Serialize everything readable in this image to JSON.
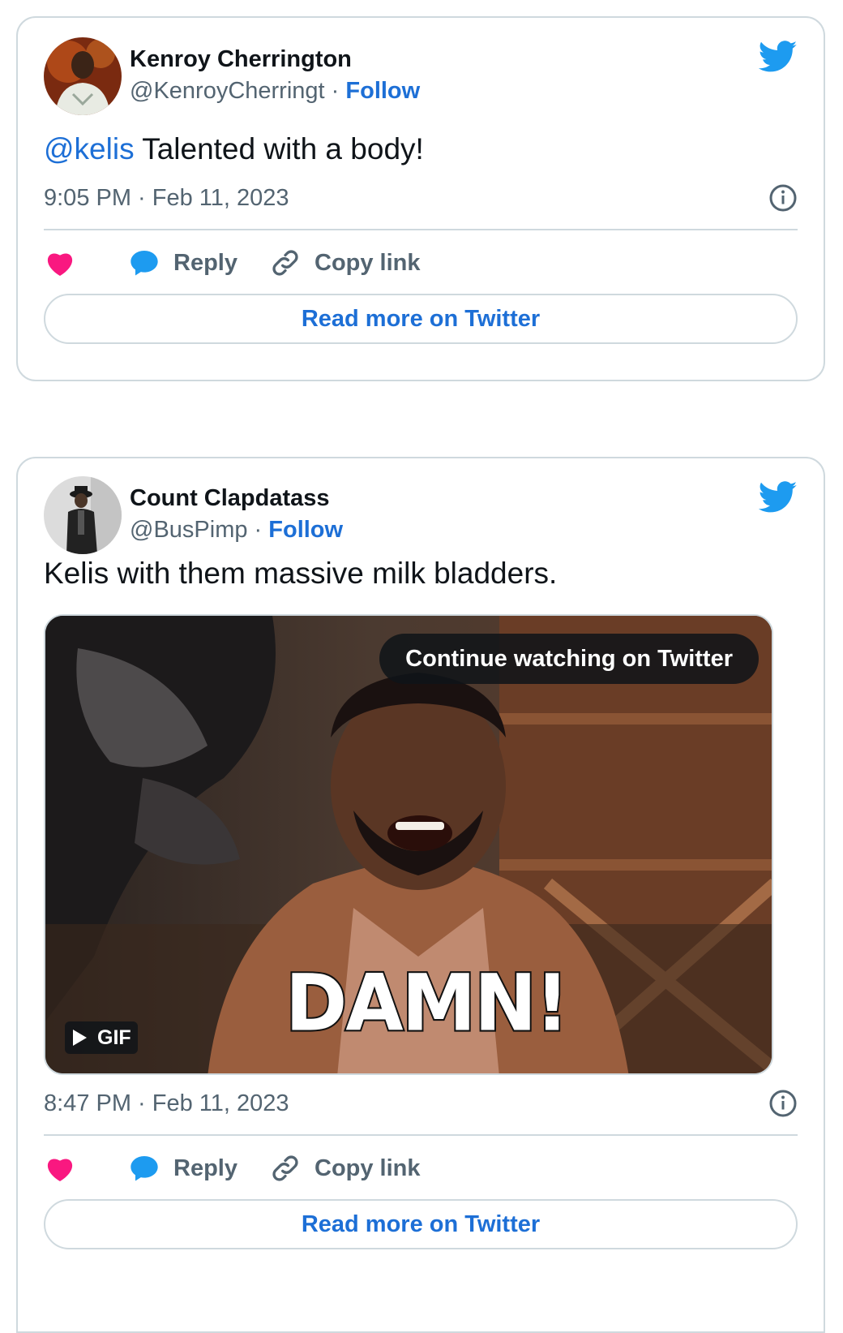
{
  "tweets": [
    {
      "author_name": "Kenroy Cherrington",
      "handle": "@KenroyCherringt",
      "separator": " · ",
      "follow_label": "Follow",
      "mention": "@kelis",
      "text": " Talented with a body!",
      "timestamp": "9:05 PM · Feb 11, 2023",
      "reply_label": "Reply",
      "copy_link_label": "Copy link",
      "read_more_label": "Read more on Twitter"
    },
    {
      "author_name": "Count Clapdatass",
      "handle": "@BusPimp",
      "separator": " · ",
      "follow_label": "Follow",
      "text": "Kelis with them massive milk bladders.",
      "media": {
        "continue_label": "Continue watching on Twitter",
        "gif_label": "GIF",
        "caption": "DAMN!"
      },
      "timestamp": "8:47 PM · Feb 11, 2023",
      "reply_label": "Reply",
      "copy_link_label": "Copy link",
      "read_more_label": "Read more on Twitter"
    }
  ],
  "colors": {
    "link_blue": "#1d6fd6",
    "twitter_blue": "#1d9bf0",
    "heart_pink": "#f91880",
    "muted_gray": "#536471",
    "border_gray": "#cfd9de"
  },
  "icons": [
    "twitter-bird-icon",
    "heart-icon",
    "reply-bubble-icon",
    "link-icon",
    "info-icon",
    "play-icon"
  ]
}
